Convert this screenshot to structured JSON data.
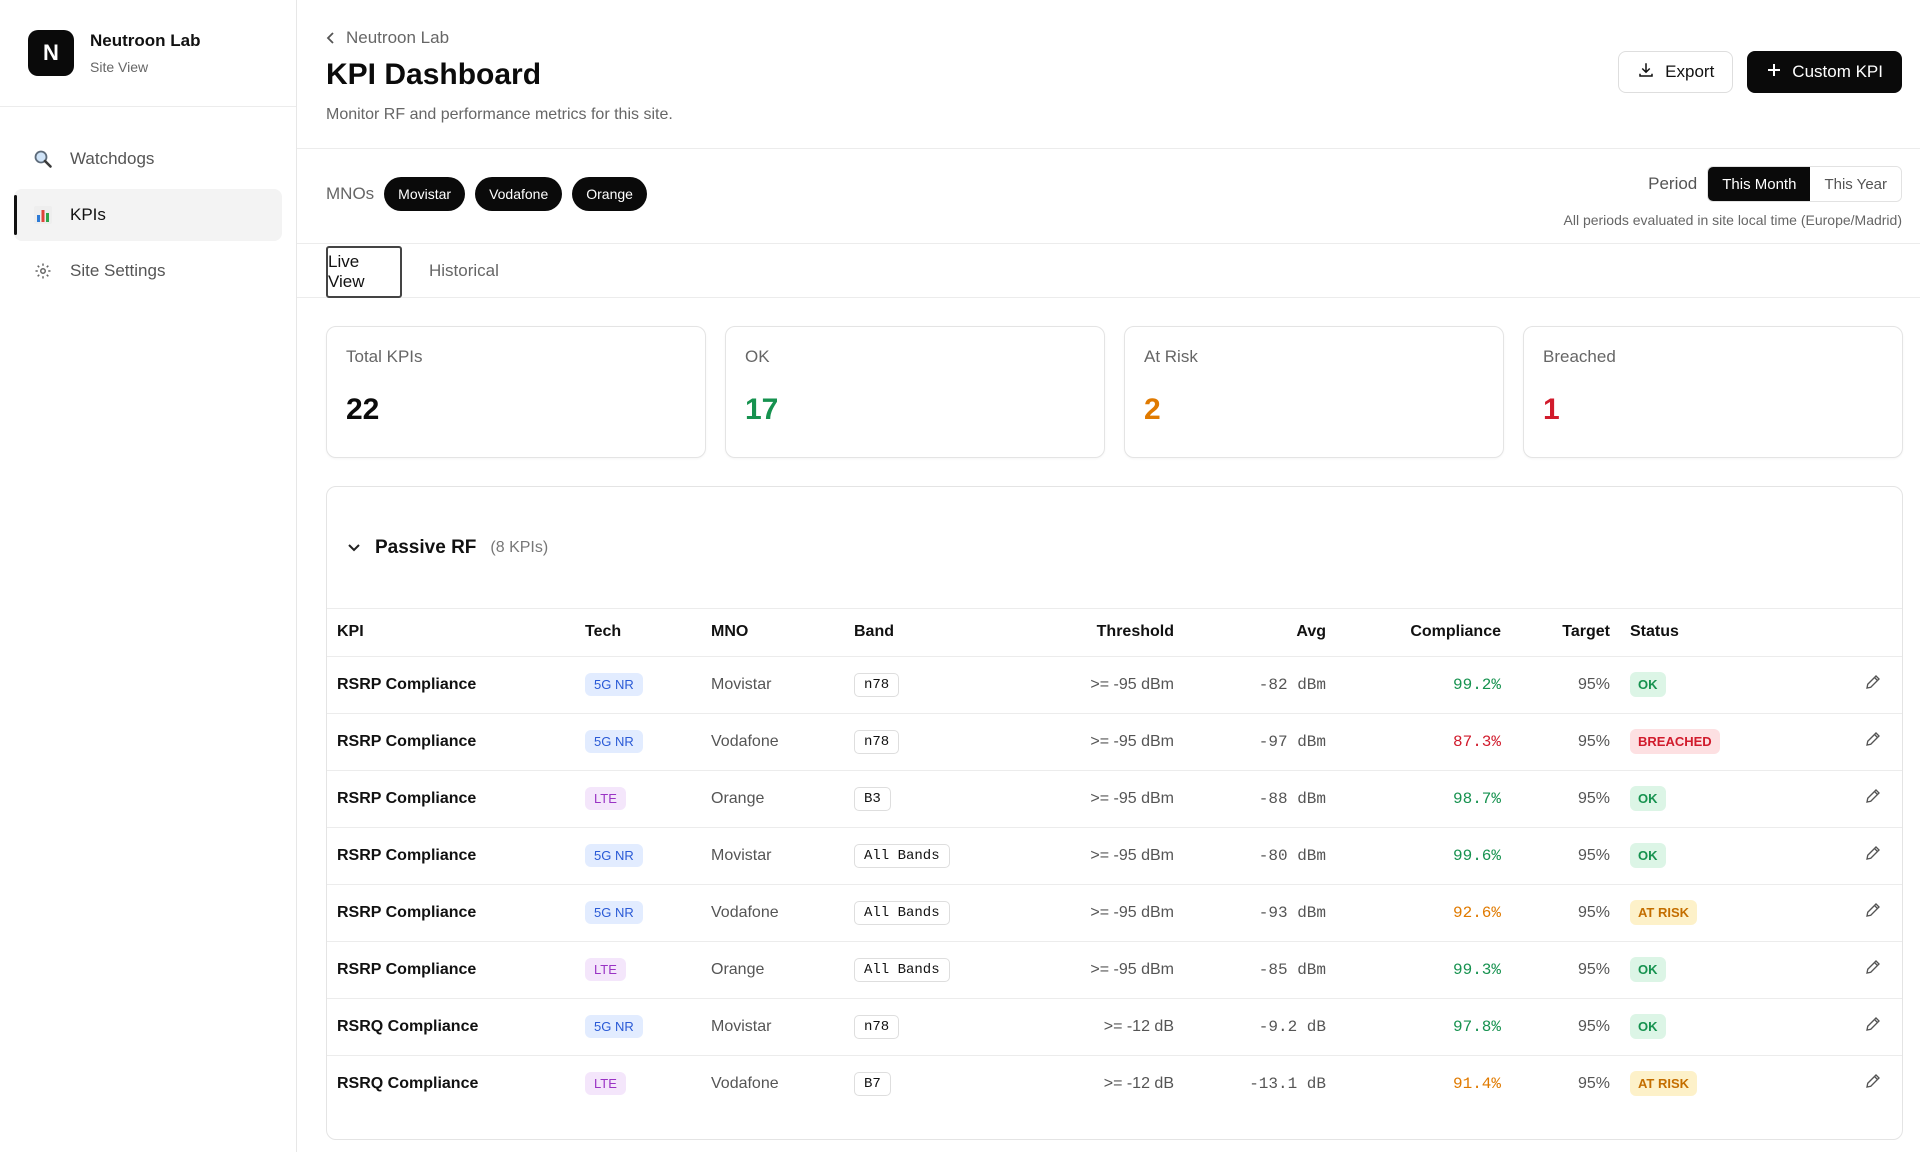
{
  "colors": {
    "ok": "#16924f",
    "at_risk": "#e07a00",
    "breached": "#d11b2c",
    "dark": "#0a0a0a"
  },
  "sidebar": {
    "brand": {
      "logo_letter": "N",
      "title": "Neutroon Lab",
      "subtitle": "Site View"
    },
    "items": [
      {
        "label": "Watchdogs",
        "icon": "magnifier-icon",
        "active": false
      },
      {
        "label": "KPIs",
        "icon": "bar-chart-icon",
        "active": true
      },
      {
        "label": "Site Settings",
        "icon": "gear-icon",
        "active": false
      }
    ]
  },
  "header": {
    "breadcrumb": "Neutroon Lab",
    "title": "KPI Dashboard",
    "description": "Monitor RF and performance metrics for this site.",
    "export_label": "Export",
    "custom_kpi_label": "Custom KPI"
  },
  "filters": {
    "mno_label": "MNOs",
    "mnos": [
      "Movistar",
      "Vodafone",
      "Orange"
    ],
    "period_label": "Period",
    "period_options": [
      "This Month",
      "This Year"
    ],
    "period_selected": "This Month",
    "period_note": "All periods evaluated in site local time (Europe/Madrid)"
  },
  "tabs": {
    "live": "Live View",
    "historical": "Historical",
    "active": "Live View"
  },
  "summary": {
    "total": {
      "label": "Total KPIs",
      "value": "22"
    },
    "ok": {
      "label": "OK",
      "value": "17"
    },
    "at_risk": {
      "label": "At Risk",
      "value": "2"
    },
    "breached": {
      "label": "Breached",
      "value": "1"
    }
  },
  "panel": {
    "title": "Passive RF",
    "count": "(8 KPIs)",
    "columns": [
      "KPI",
      "Tech",
      "MNO",
      "Band",
      "Threshold",
      "Avg",
      "Compliance",
      "Target",
      "Status"
    ],
    "rows": [
      {
        "kpi": "RSRP Compliance",
        "tech": "5G NR",
        "mno": "Movistar",
        "band": "n78",
        "threshold": ">= -95 dBm",
        "avg": "-82 dBm",
        "compliance": "99.2%",
        "target": "95%",
        "status": "OK"
      },
      {
        "kpi": "RSRP Compliance",
        "tech": "5G NR",
        "mno": "Vodafone",
        "band": "n78",
        "threshold": ">= -95 dBm",
        "avg": "-97 dBm",
        "compliance": "87.3%",
        "target": "95%",
        "status": "BREACHED"
      },
      {
        "kpi": "RSRP Compliance",
        "tech": "LTE",
        "mno": "Orange",
        "band": "B3",
        "threshold": ">= -95 dBm",
        "avg": "-88 dBm",
        "compliance": "98.7%",
        "target": "95%",
        "status": "OK"
      },
      {
        "kpi": "RSRP Compliance",
        "tech": "5G NR",
        "mno": "Movistar",
        "band": "All Bands",
        "threshold": ">= -95 dBm",
        "avg": "-80 dBm",
        "compliance": "99.6%",
        "target": "95%",
        "status": "OK"
      },
      {
        "kpi": "RSRP Compliance",
        "tech": "5G NR",
        "mno": "Vodafone",
        "band": "All Bands",
        "threshold": ">= -95 dBm",
        "avg": "-93 dBm",
        "compliance": "92.6%",
        "target": "95%",
        "status": "AT RISK"
      },
      {
        "kpi": "RSRP Compliance",
        "tech": "LTE",
        "mno": "Orange",
        "band": "All Bands",
        "threshold": ">= -95 dBm",
        "avg": "-85 dBm",
        "compliance": "99.3%",
        "target": "95%",
        "status": "OK"
      },
      {
        "kpi": "RSRQ Compliance",
        "tech": "5G NR",
        "mno": "Movistar",
        "band": "n78",
        "threshold": ">= -12 dB",
        "avg": "-9.2 dB",
        "compliance": "97.8%",
        "target": "95%",
        "status": "OK"
      },
      {
        "kpi": "RSRQ Compliance",
        "tech": "LTE",
        "mno": "Vodafone",
        "band": "B7",
        "threshold": ">= -12 dB",
        "avg": "-13.1 dB",
        "compliance": "91.4%",
        "target": "95%",
        "status": "AT RISK"
      }
    ]
  }
}
